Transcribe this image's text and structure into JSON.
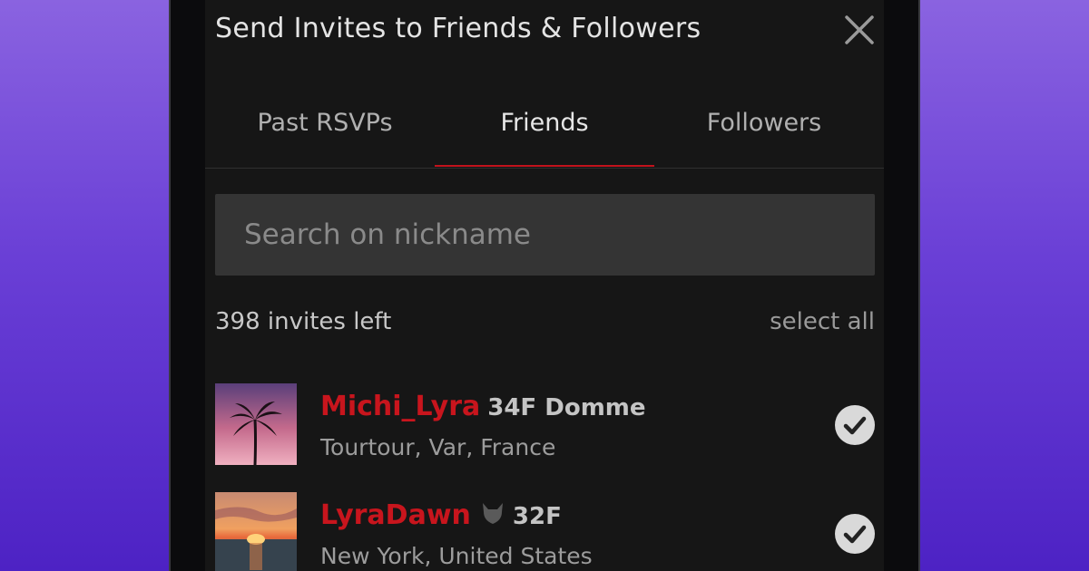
{
  "modal": {
    "title": "Send Invites to Friends & Followers",
    "close_icon": "close-icon"
  },
  "tabs": [
    {
      "label": "Past RSVPs",
      "active": false
    },
    {
      "label": "Friends",
      "active": true
    },
    {
      "label": "Followers",
      "active": false
    }
  ],
  "search": {
    "placeholder": "Search on nickname",
    "value": ""
  },
  "invites": {
    "left_text": "398 invites left",
    "select_all_label": "select all"
  },
  "users": [
    {
      "nickname": "Michi_Lyra",
      "meta": "34F Domme",
      "location": "Tourtour, Var, France",
      "selected": true,
      "avatar": "palm-tree-sunset"
    },
    {
      "nickname": "LyraDawn",
      "meta": "32F",
      "badge_icon": "devil-badge-icon",
      "location": "New York, United States",
      "selected": true,
      "avatar": "ocean-sunset"
    }
  ],
  "colors": {
    "accent": "#c2121c",
    "background": "#161616",
    "search_bg": "#343434",
    "gradient_top": "#8a63e0",
    "gradient_bottom": "#4d22c4"
  }
}
